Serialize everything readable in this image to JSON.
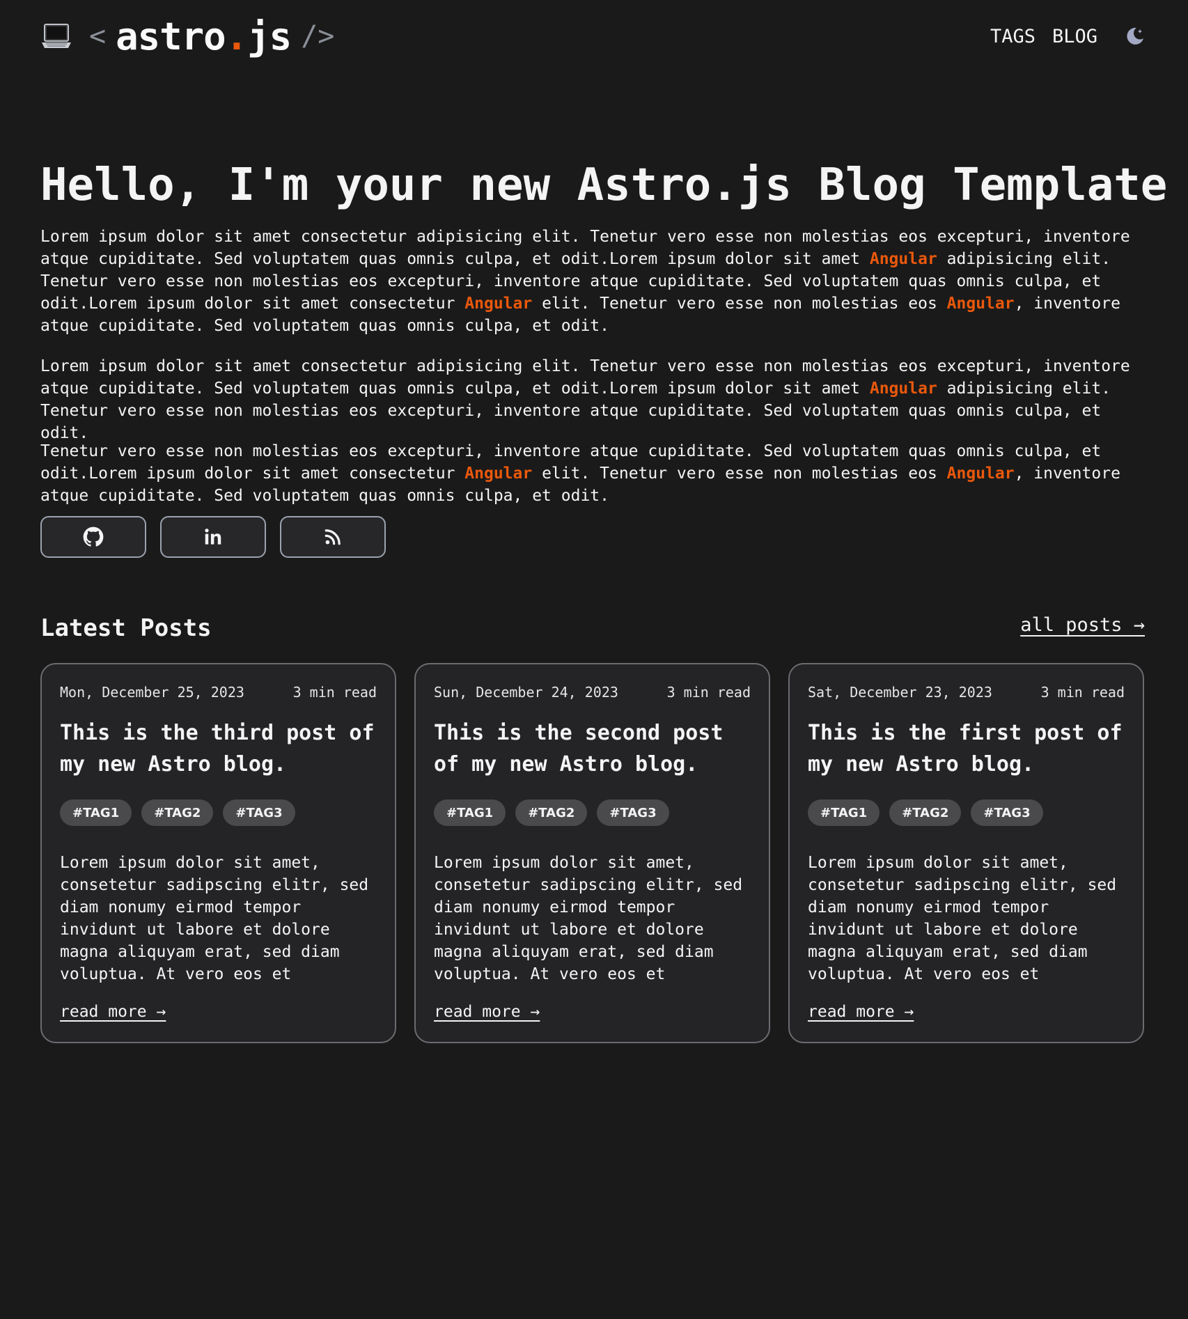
{
  "colors": {
    "background": "#1a1a1a",
    "card_background": "#242326",
    "accent": "#ea580c",
    "text": "#f4f4f5",
    "muted": "#8a8f98"
  },
  "header": {
    "logo_icon": "laptop-icon",
    "logo_open": "<",
    "logo_name": "astro",
    "logo_dot": ".",
    "logo_ext": "js",
    "logo_close": "/>",
    "nav": [
      {
        "label": "TAGS"
      },
      {
        "label": "BLOG"
      }
    ],
    "theme_toggle_icon": "moon-icon"
  },
  "hero": {
    "title": "Hello, I'm your new Astro.js Blog Template",
    "title_icon": "rocket-icon",
    "paragraphs": [
      [
        {
          "text": "Lorem ipsum dolor sit amet consectetur adipisicing elit. Tenetur vero esse non molestias eos excepturi, inventore atque cupiditate. Sed voluptatem quas omnis culpa, et odit.Lorem ipsum dolor sit amet "
        },
        {
          "text": "Angular",
          "highlight": true
        },
        {
          "text": " adipisicing elit. Tenetur vero esse non molestias eos excepturi, inventore atque cupiditate. Sed voluptatem quas omnis culpa, et odit.Lorem ipsum dolor sit amet consectetur "
        },
        {
          "text": "Angular",
          "highlight": true
        },
        {
          "text": " elit. Tenetur vero esse non molestias eos "
        },
        {
          "text": "Angular",
          "highlight": true
        },
        {
          "text": ", inventore atque cupiditate. Sed voluptatem quas omnis culpa, et odit."
        }
      ],
      [
        {
          "text": "Lorem ipsum dolor sit amet consectetur adipisicing elit. Tenetur vero esse non molestias eos excepturi, inventore atque cupiditate. Sed voluptatem quas omnis culpa, et odit.Lorem ipsum dolor sit amet "
        },
        {
          "text": "Angular",
          "highlight": true
        },
        {
          "text": " adipisicing elit. Tenetur vero esse non molestias eos excepturi, inventore atque cupiditate. Sed voluptatem quas omnis culpa, et odit."
        }
      ],
      [
        {
          "text": "Tenetur vero esse non molestias eos excepturi, inventore atque cupiditate. Sed voluptatem quas omnis culpa, et odit.Lorem ipsum dolor sit amet consectetur "
        },
        {
          "text": "Angular",
          "highlight": true
        },
        {
          "text": " elit. Tenetur vero esse non molestias eos "
        },
        {
          "text": "Angular",
          "highlight": true
        },
        {
          "text": ", inventore atque cupiditate. Sed voluptatem quas omnis culpa, et odit."
        }
      ]
    ],
    "socials": [
      {
        "icon": "github-icon"
      },
      {
        "icon": "linkedin-icon"
      },
      {
        "icon": "rss-icon"
      }
    ]
  },
  "latest": {
    "title": "Latest Posts",
    "all_posts_label": "all posts →",
    "posts": [
      {
        "date": "Mon, December 25, 2023",
        "read_time": "3 min read",
        "title": "This is the third post of my new Astro blog.",
        "tags": [
          "#TAG1",
          "#TAG2",
          "#TAG3"
        ],
        "excerpt": "Lorem ipsum dolor sit amet, consetetur sadipscing elitr, sed diam nonumy eirmod tempor invidunt ut labore et dolore magna aliquyam erat, sed diam voluptua. At vero eos et accusam…",
        "read_more": "read more →"
      },
      {
        "date": "Sun, December 24, 2023",
        "read_time": "3 min read",
        "title": "This is the second post of my new Astro blog.",
        "tags": [
          "#TAG1",
          "#TAG2",
          "#TAG3"
        ],
        "excerpt": "Lorem ipsum dolor sit amet, consetetur sadipscing elitr, sed diam nonumy eirmod tempor invidunt ut labore et dolore magna aliquyam erat, sed diam voluptua. At vero eos et accusam…",
        "read_more": "read more →"
      },
      {
        "date": "Sat, December 23, 2023",
        "read_time": "3 min read",
        "title": "This is the first post of my new Astro blog.",
        "tags": [
          "#TAG1",
          "#TAG2",
          "#TAG3"
        ],
        "excerpt": "Lorem ipsum dolor sit amet, consetetur sadipscing elitr, sed diam nonumy eirmod tempor invidunt ut labore et dolore magna aliquyam erat, sed diam voluptua. At vero eos et accusam…",
        "read_more": "read more →"
      }
    ]
  }
}
